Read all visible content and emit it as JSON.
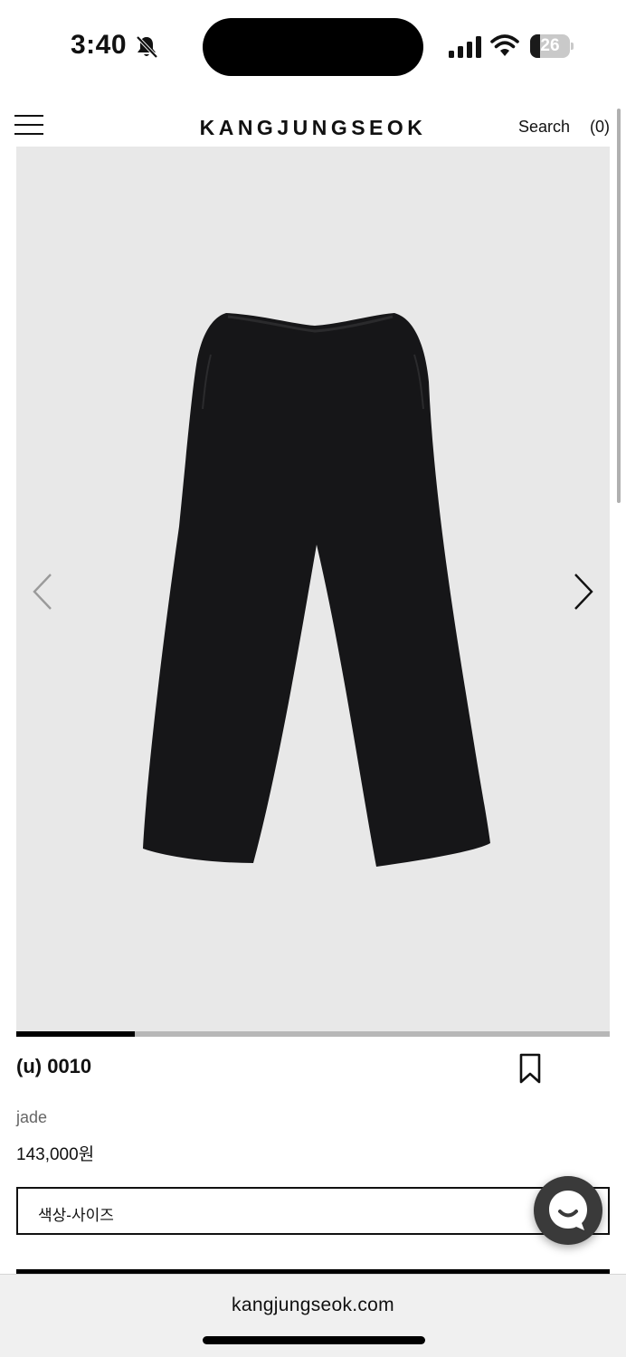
{
  "status_bar": {
    "time": "3:40",
    "battery_level": "26",
    "battery_fraction": 0.26
  },
  "header": {
    "brand": "KANGJUNGSEOK",
    "search_label": "Search",
    "cart_label": "(0)"
  },
  "gallery": {
    "image": "black-pants-icon",
    "background_color": "#e8e8e8",
    "progress_fraction": 0.2
  },
  "product": {
    "name": "(u) 0010",
    "color": "jade",
    "price": "143,000원"
  },
  "options": {
    "select_label": "색상-사이즈"
  },
  "browser": {
    "url": "kangjungseok.com"
  }
}
